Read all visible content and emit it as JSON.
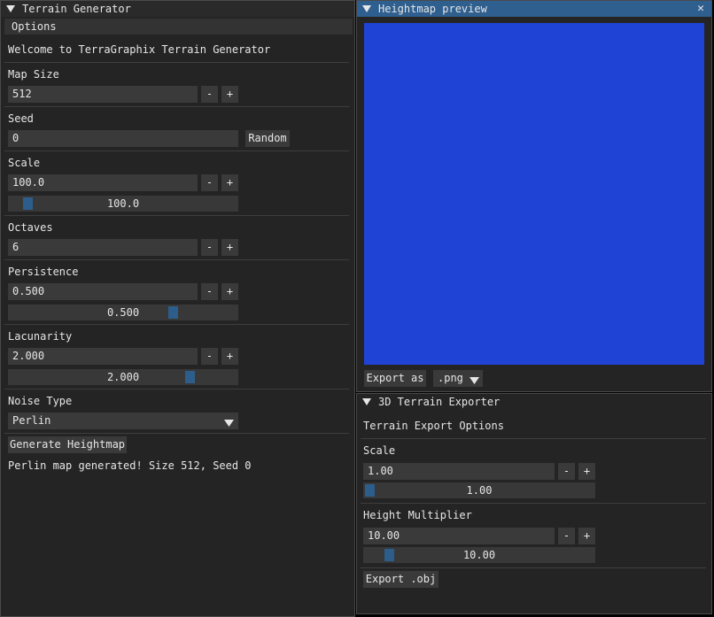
{
  "terrain_generator": {
    "title": "Terrain Generator",
    "options_header": "Options",
    "welcome": "Welcome to TerraGraphix Terrain Generator",
    "map_size": {
      "label": "Map Size",
      "value": "512"
    },
    "seed": {
      "label": "Seed",
      "value": "0",
      "random_label": "Random"
    },
    "scale": {
      "label": "Scale",
      "value": "100.0",
      "slider_value": "100.0",
      "slider_fraction": 0.06
    },
    "octaves": {
      "label": "Octaves",
      "value": "6"
    },
    "persistence": {
      "label": "Persistence",
      "value": "0.500",
      "slider_value": "0.500",
      "slider_fraction": 0.73
    },
    "lacunarity": {
      "label": "Lacunarity",
      "value": "2.000",
      "slider_value": "2.000",
      "slider_fraction": 0.81
    },
    "noise_type": {
      "label": "Noise Type",
      "value": "Perlin"
    },
    "generate_label": "Generate Heightmap",
    "status": "Perlin map generated! Size 512, Seed 0",
    "minus": "-",
    "plus": "+"
  },
  "heightmap_preview": {
    "title": "Heightmap preview",
    "close": "✕",
    "export_as_label": "Export as",
    "format_value": ".png",
    "colors": {
      "deep_water": "#1f44d6",
      "water": "#1f9bd9",
      "grass": "#2cd98a",
      "sand": "#f2ec9a",
      "dirt": "#8a6e54",
      "rock": "#5c4a40",
      "snow": "#e9e9e9"
    }
  },
  "terrain_exporter": {
    "title": "3D Terrain Exporter",
    "header": "Terrain Export Options",
    "scale": {
      "label": "Scale",
      "value": "1.00",
      "slider_value": "1.00",
      "slider_fraction": 0.0
    },
    "height_multiplier": {
      "label": "Height Multiplier",
      "value": "10.00",
      "slider_value": "10.00",
      "slider_fraction": 0.09
    },
    "export_obj_label": "Export .obj",
    "minus": "-",
    "plus": "+"
  },
  "theme": {
    "accent": "#2e5f8e",
    "slider_grab": "#2d5e8b",
    "frame": "#3a3a3a",
    "window": "#242424"
  }
}
